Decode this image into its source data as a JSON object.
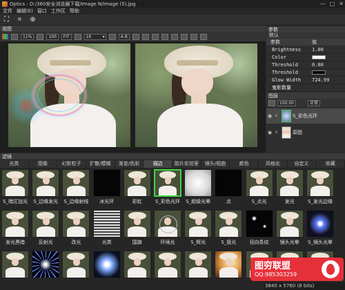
{
  "window": {
    "title": "Optics : D:/360安全浏览器下载/Image N/image (5).jpg",
    "controls": [
      "—",
      "□",
      "✕"
    ]
  },
  "menu": [
    "文件",
    "编辑(E)",
    "窗口",
    "工作区",
    "帮助"
  ],
  "toolbar_icons": [
    "fit-icon",
    "crop-icon",
    "orbit-icon"
  ],
  "viewer": {
    "header": "视图",
    "zoom": "11%",
    "buttons": [
      "100",
      "FIT"
    ],
    "preview_size": "1K",
    "compare_label": "A B"
  },
  "params": {
    "header": "参数",
    "preset": "默认",
    "columns": [
      "参数",
      "值"
    ],
    "rows": [
      {
        "name": "Brightness",
        "value": "1.00"
      },
      {
        "name": "Color",
        "value": ""
      },
      {
        "name": "Threshold",
        "value": "0.00"
      },
      {
        "name": "Threshold",
        "value": ""
      },
      {
        "name": "Glow Width",
        "value": "724.99"
      },
      {
        "name": "鬼影数量",
        "value": ""
      }
    ]
  },
  "layers": {
    "header": "图层",
    "opacity": "100.00",
    "blend": "正常",
    "items": [
      {
        "name": "S_彩色光环",
        "selected": true
      },
      {
        "name": "原图",
        "selected": false
      }
    ]
  },
  "filters": {
    "header": "滤镜",
    "tabs": [
      "光类",
      "图像",
      "幻影粒子",
      "扩散/模糊",
      "渐变/色彩",
      "描边",
      "胶片实验室",
      "镜头/相曲",
      "颜色",
      "风格化",
      "自定义",
      "收藏"
    ],
    "active_tab": "描边",
    "row1": [
      "S_暗区加光",
      "S_边缘发光",
      "S_边缘射线",
      "冰光环",
      "彩虹",
      "S_彩色光环",
      "S_超级光晕",
      "点",
      "S_点光",
      "发光",
      "S_发光边缘"
    ],
    "row2": [
      "发光黑暗",
      "反射光",
      "改光",
      "光类",
      "国旗",
      "环境光",
      "S_辉光",
      "S_极光",
      "径向条纹",
      "镜头光晕",
      "S_镜头光晕"
    ],
    "row3": [
      "",
      "",
      "",
      "",
      "",
      "",
      "",
      "",
      "",
      "",
      ""
    ],
    "selected": "S_彩色光环"
  },
  "status": "3840 x 5760 (8 bits)",
  "watermark": {
    "title": "图穷联盟",
    "sub": "QQ:985303259"
  }
}
